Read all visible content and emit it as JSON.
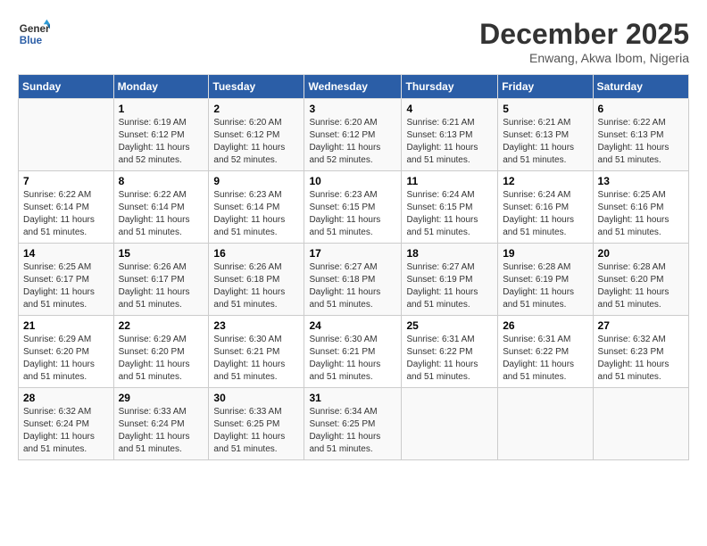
{
  "logo": {
    "line1": "General",
    "line2": "Blue"
  },
  "title": "December 2025",
  "subtitle": "Enwang, Akwa Ibom, Nigeria",
  "days_of_week": [
    "Sunday",
    "Monday",
    "Tuesday",
    "Wednesday",
    "Thursday",
    "Friday",
    "Saturday"
  ],
  "weeks": [
    [
      {
        "day": "",
        "info": ""
      },
      {
        "day": "1",
        "info": "Sunrise: 6:19 AM\nSunset: 6:12 PM\nDaylight: 11 hours\nand 52 minutes."
      },
      {
        "day": "2",
        "info": "Sunrise: 6:20 AM\nSunset: 6:12 PM\nDaylight: 11 hours\nand 52 minutes."
      },
      {
        "day": "3",
        "info": "Sunrise: 6:20 AM\nSunset: 6:12 PM\nDaylight: 11 hours\nand 52 minutes."
      },
      {
        "day": "4",
        "info": "Sunrise: 6:21 AM\nSunset: 6:13 PM\nDaylight: 11 hours\nand 51 minutes."
      },
      {
        "day": "5",
        "info": "Sunrise: 6:21 AM\nSunset: 6:13 PM\nDaylight: 11 hours\nand 51 minutes."
      },
      {
        "day": "6",
        "info": "Sunrise: 6:22 AM\nSunset: 6:13 PM\nDaylight: 11 hours\nand 51 minutes."
      }
    ],
    [
      {
        "day": "7",
        "info": "Sunrise: 6:22 AM\nSunset: 6:14 PM\nDaylight: 11 hours\nand 51 minutes."
      },
      {
        "day": "8",
        "info": "Sunrise: 6:22 AM\nSunset: 6:14 PM\nDaylight: 11 hours\nand 51 minutes."
      },
      {
        "day": "9",
        "info": "Sunrise: 6:23 AM\nSunset: 6:14 PM\nDaylight: 11 hours\nand 51 minutes."
      },
      {
        "day": "10",
        "info": "Sunrise: 6:23 AM\nSunset: 6:15 PM\nDaylight: 11 hours\nand 51 minutes."
      },
      {
        "day": "11",
        "info": "Sunrise: 6:24 AM\nSunset: 6:15 PM\nDaylight: 11 hours\nand 51 minutes."
      },
      {
        "day": "12",
        "info": "Sunrise: 6:24 AM\nSunset: 6:16 PM\nDaylight: 11 hours\nand 51 minutes."
      },
      {
        "day": "13",
        "info": "Sunrise: 6:25 AM\nSunset: 6:16 PM\nDaylight: 11 hours\nand 51 minutes."
      }
    ],
    [
      {
        "day": "14",
        "info": "Sunrise: 6:25 AM\nSunset: 6:17 PM\nDaylight: 11 hours\nand 51 minutes."
      },
      {
        "day": "15",
        "info": "Sunrise: 6:26 AM\nSunset: 6:17 PM\nDaylight: 11 hours\nand 51 minutes."
      },
      {
        "day": "16",
        "info": "Sunrise: 6:26 AM\nSunset: 6:18 PM\nDaylight: 11 hours\nand 51 minutes."
      },
      {
        "day": "17",
        "info": "Sunrise: 6:27 AM\nSunset: 6:18 PM\nDaylight: 11 hours\nand 51 minutes."
      },
      {
        "day": "18",
        "info": "Sunrise: 6:27 AM\nSunset: 6:19 PM\nDaylight: 11 hours\nand 51 minutes."
      },
      {
        "day": "19",
        "info": "Sunrise: 6:28 AM\nSunset: 6:19 PM\nDaylight: 11 hours\nand 51 minutes."
      },
      {
        "day": "20",
        "info": "Sunrise: 6:28 AM\nSunset: 6:20 PM\nDaylight: 11 hours\nand 51 minutes."
      }
    ],
    [
      {
        "day": "21",
        "info": "Sunrise: 6:29 AM\nSunset: 6:20 PM\nDaylight: 11 hours\nand 51 minutes."
      },
      {
        "day": "22",
        "info": "Sunrise: 6:29 AM\nSunset: 6:20 PM\nDaylight: 11 hours\nand 51 minutes."
      },
      {
        "day": "23",
        "info": "Sunrise: 6:30 AM\nSunset: 6:21 PM\nDaylight: 11 hours\nand 51 minutes."
      },
      {
        "day": "24",
        "info": "Sunrise: 6:30 AM\nSunset: 6:21 PM\nDaylight: 11 hours\nand 51 minutes."
      },
      {
        "day": "25",
        "info": "Sunrise: 6:31 AM\nSunset: 6:22 PM\nDaylight: 11 hours\nand 51 minutes."
      },
      {
        "day": "26",
        "info": "Sunrise: 6:31 AM\nSunset: 6:22 PM\nDaylight: 11 hours\nand 51 minutes."
      },
      {
        "day": "27",
        "info": "Sunrise: 6:32 AM\nSunset: 6:23 PM\nDaylight: 11 hours\nand 51 minutes."
      }
    ],
    [
      {
        "day": "28",
        "info": "Sunrise: 6:32 AM\nSunset: 6:24 PM\nDaylight: 11 hours\nand 51 minutes."
      },
      {
        "day": "29",
        "info": "Sunrise: 6:33 AM\nSunset: 6:24 PM\nDaylight: 11 hours\nand 51 minutes."
      },
      {
        "day": "30",
        "info": "Sunrise: 6:33 AM\nSunset: 6:25 PM\nDaylight: 11 hours\nand 51 minutes."
      },
      {
        "day": "31",
        "info": "Sunrise: 6:34 AM\nSunset: 6:25 PM\nDaylight: 11 hours\nand 51 minutes."
      },
      {
        "day": "",
        "info": ""
      },
      {
        "day": "",
        "info": ""
      },
      {
        "day": "",
        "info": ""
      }
    ]
  ]
}
